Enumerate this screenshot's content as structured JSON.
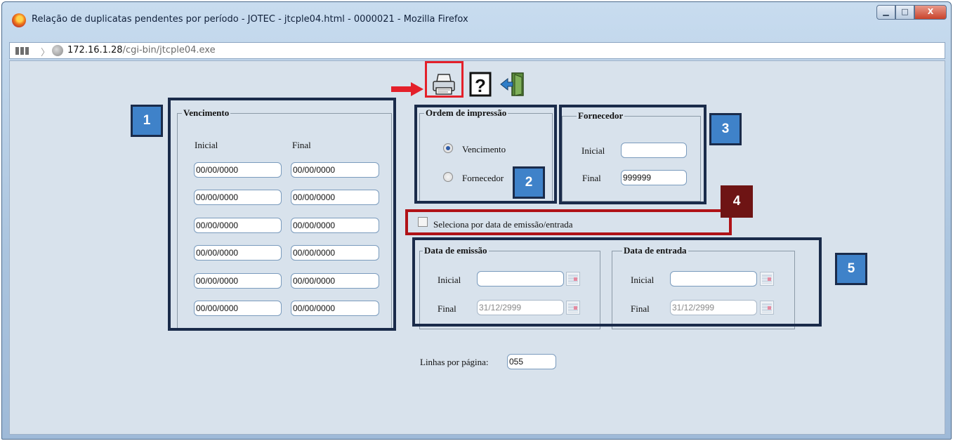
{
  "window": {
    "title": "Relação de duplicatas pendentes por período - JOTEC - jtcple04.html - 0000021 - Mozilla Firefox",
    "controls": {
      "minimize": "▁",
      "maximize": "□",
      "close": "X"
    }
  },
  "urlbar": {
    "host": "172.16.1.28",
    "path": "/cgi-bin/jtcple04.exe"
  },
  "toolbar": {
    "print_icon": "printer-icon",
    "help_icon": "help-icon",
    "exit_icon": "exit-door-icon"
  },
  "vencimento": {
    "legend": "Vencimento",
    "col_initial": "Inicial",
    "col_final": "Final",
    "rows": [
      {
        "initial": "00/00/0000",
        "final": "00/00/0000"
      },
      {
        "initial": "00/00/0000",
        "final": "00/00/0000"
      },
      {
        "initial": "00/00/0000",
        "final": "00/00/0000"
      },
      {
        "initial": "00/00/0000",
        "final": "00/00/0000"
      },
      {
        "initial": "00/00/0000",
        "final": "00/00/0000"
      },
      {
        "initial": "00/00/0000",
        "final": "00/00/0000"
      }
    ]
  },
  "ordem": {
    "legend": "Ordem de impressão",
    "options": [
      {
        "label": "Vencimento",
        "selected": true
      },
      {
        "label": "Fornecedor",
        "selected": false
      }
    ]
  },
  "fornecedor": {
    "legend": "Fornecedor",
    "initial_label": "Inicial",
    "initial_value": "",
    "final_label": "Final",
    "final_value": "999999"
  },
  "seleciona": {
    "label": "Seleciona por data de emissão/entrada",
    "checked": false
  },
  "emissao": {
    "legend": "Data de emissão",
    "initial_label": "Inicial",
    "initial_value": "",
    "final_label": "Final",
    "final_value": "31/12/2999"
  },
  "entrada": {
    "legend": "Data de entrada",
    "initial_label": "Inicial",
    "initial_value": "",
    "final_label": "Final",
    "final_value": "31/12/2999"
  },
  "linhas": {
    "label": "Linhas por página:",
    "value": "055"
  },
  "annotations": [
    "1",
    "2",
    "3",
    "4",
    "5"
  ],
  "colors": {
    "annotation_blue": "#3f82c9",
    "annotation_dark": "#6e1414",
    "frame": "#1a2b4a",
    "highlight_red": "#e4202a"
  }
}
